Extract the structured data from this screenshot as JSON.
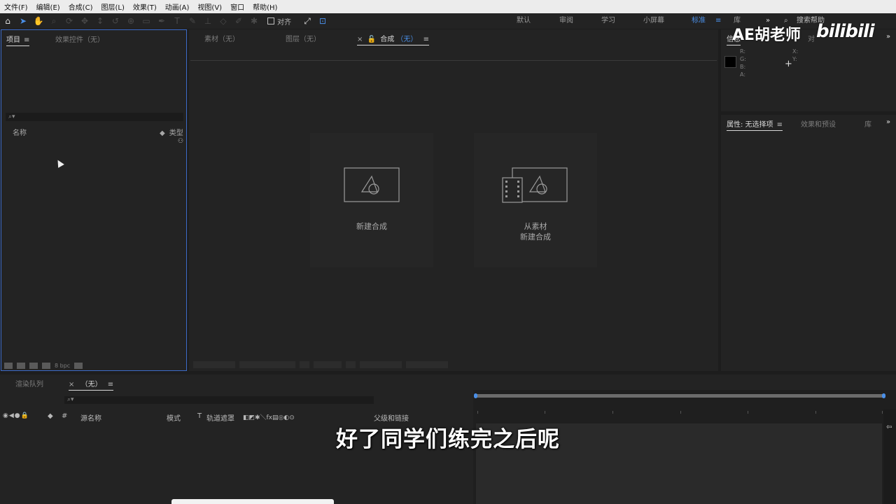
{
  "menu": [
    "文件(F)",
    "编辑(E)",
    "合成(C)",
    "图层(L)",
    "效果(T)",
    "动画(A)",
    "视图(V)",
    "窗口",
    "帮助(H)"
  ],
  "toolbar": {
    "align_label": "对齐",
    "workspaces": [
      "默认",
      "审阅",
      "学习",
      "小屏幕",
      "标准",
      "库"
    ],
    "active_workspace": "标准",
    "search_help": "搜索帮助"
  },
  "project_panel": {
    "tab_project": "项目",
    "tab_effects": "效果控件（无）",
    "col_name": "名称",
    "col_type": "类型",
    "bpc": "8 bpc"
  },
  "comp_panel": {
    "tab_footage": "素材（无）",
    "tab_layer": "图层（无）",
    "tab_comp": "合成",
    "tab_comp_suffix": "（无）",
    "new_comp": "新建合成",
    "from_footage_line1": "从素材",
    "from_footage_line2": "新建合成"
  },
  "info_panel": {
    "tab": "信息",
    "tab_audio": "对",
    "channels": [
      "R:",
      "G:",
      "B:",
      "A:"
    ],
    "coords": [
      "X:",
      "Y:"
    ]
  },
  "props_panel": {
    "tab_props": "属性: 无选择项",
    "tab_effects": "效果和预设",
    "tab_library": "库"
  },
  "timeline_panel": {
    "tab_render": "渲染队列",
    "tab_comp": "（无）",
    "col_hash": "#",
    "col_source": "源名称",
    "col_mode": "模式",
    "col_t": "T",
    "col_trackmatte": "轨道遮罩",
    "col_parent": "父级和链接"
  },
  "overlay": {
    "subtitle": "好了同学们练完之后呢",
    "watermark": "AE胡老师",
    "brand": "bilibili"
  },
  "colors": {
    "accent": "#4a8fe8",
    "panel_bg": "#232323",
    "menu_bg": "#ececec"
  }
}
